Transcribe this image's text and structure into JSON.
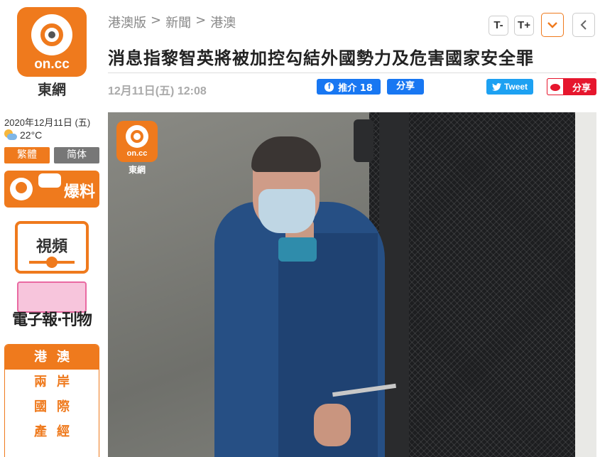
{
  "brand": {
    "logo_text": "on.cc",
    "logo_sub": "東網",
    "accent_color": "#ef7a1d"
  },
  "sidebar": {
    "date": "2020年12月11日 (五)",
    "weather": {
      "icon": "partly-cloudy-icon",
      "temp": "22°C"
    },
    "lang": {
      "traditional": "繁體",
      "simplified": "简体"
    },
    "banners": {
      "tip": "爆料",
      "video": "視頻",
      "paper": "電子報‧刊物"
    },
    "sections": [
      {
        "label": "港澳",
        "active": true
      },
      {
        "label": "兩岸",
        "active": false
      },
      {
        "label": "國際",
        "active": false
      },
      {
        "label": "產經",
        "active": false
      }
    ]
  },
  "breadcrumb": [
    "港澳版",
    "新聞",
    "港澳"
  ],
  "breadcrumb_sep": ">",
  "toolbar": {
    "font_smaller": "T-",
    "font_larger": "T+",
    "expand_icon": "chevron-down-icon",
    "back_icon": "chevron-left-icon"
  },
  "article": {
    "headline": "消息指黎智英將被加控勾結外國勢力及危害國家安全罪",
    "timestamp": "12月11日(五) 12:08",
    "photo_watermark": {
      "logo_text": "on.cc",
      "sub": "東網"
    }
  },
  "social": {
    "facebook_like": "推介 18",
    "facebook_share": "分享",
    "tweet": "Tweet",
    "weibo_share": "分享"
  }
}
